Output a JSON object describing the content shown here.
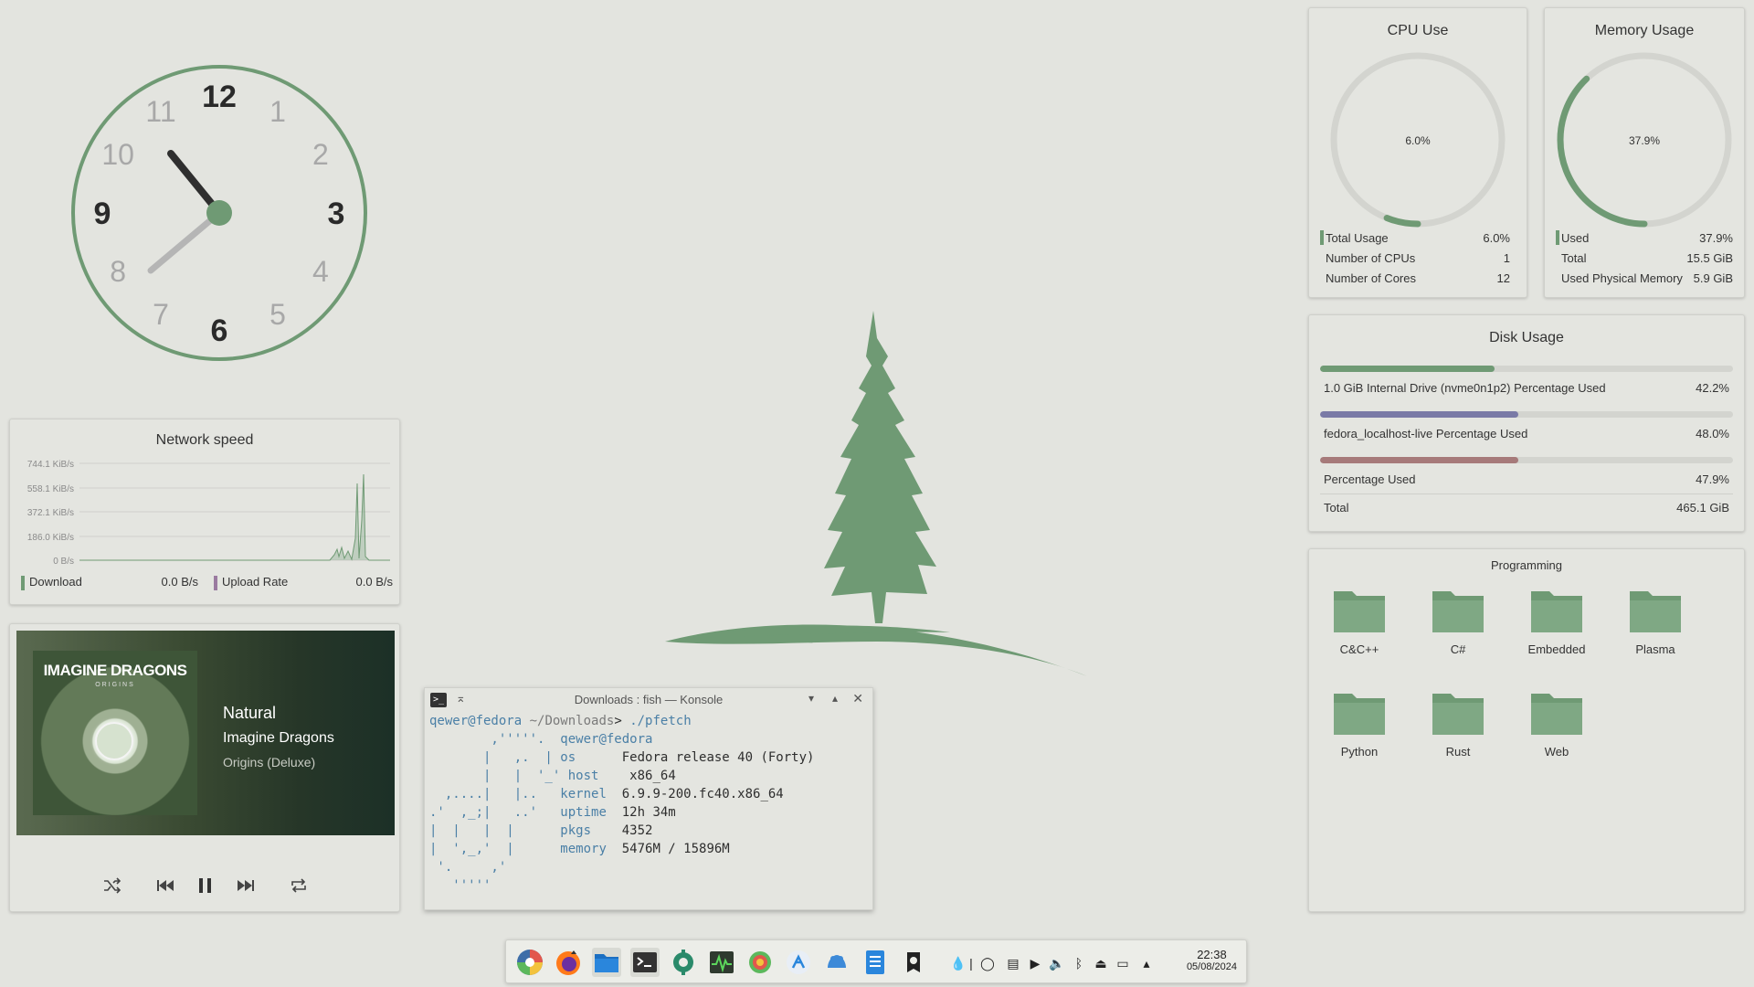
{
  "clock": {
    "numerals": [
      "12",
      "1",
      "2",
      "3",
      "4",
      "5",
      "6",
      "7",
      "8",
      "9",
      "10",
      "11"
    ],
    "time": "22:38"
  },
  "cpu": {
    "title": "CPU Use",
    "gauge_label": "6.0%",
    "gauge_fraction": 0.06,
    "rows": [
      {
        "label": "Total Usage",
        "value": "6.0%"
      },
      {
        "label": "Number of CPUs",
        "value": "1"
      },
      {
        "label": "Number of Cores",
        "value": "12"
      }
    ]
  },
  "memory": {
    "title": "Memory Usage",
    "gauge_label": "37.9%",
    "gauge_fraction": 0.379,
    "rows": [
      {
        "label": "Used",
        "value": "37.9%"
      },
      {
        "label": "Total",
        "value": "15.5 GiB"
      },
      {
        "label": "Used Physical Memory",
        "value": "5.9 GiB"
      }
    ]
  },
  "disk": {
    "title": "Disk Usage",
    "entries": [
      {
        "label": "1.0 GiB Internal Drive (nvme0n1p2) Percentage Used",
        "value": "42.2%",
        "fraction": 0.422,
        "color": "#6f9a74"
      },
      {
        "label": "fedora_localhost-live Percentage Used",
        "value": "48.0%",
        "fraction": 0.48,
        "color": "#7a7aa6"
      },
      {
        "label": "Percentage Used",
        "value": "47.9%",
        "fraction": 0.479,
        "color": "#a67a7a"
      }
    ],
    "total_label": "Total",
    "total_value": "465.1 GiB"
  },
  "folders": {
    "title": "Programming",
    "items": [
      "C&C++",
      "C#",
      "Embedded",
      "Plasma",
      "Python",
      "Rust",
      "Web"
    ]
  },
  "network": {
    "title": "Network speed",
    "y_ticks": [
      "744.1 KiB/s",
      "558.1 KiB/s",
      "372.1 KiB/s",
      "186.0 KiB/s",
      "0 B/s"
    ],
    "download_label": "Download",
    "download_value": "0.0 B/s",
    "upload_label": "Upload Rate",
    "upload_value": "0.0 B/s",
    "download_color": "#6f9a74",
    "upload_color": "#9a7aa0"
  },
  "media": {
    "album_band": "IMAGINE DRAGONS",
    "album_sub": "ORIGINS",
    "track": "Natural",
    "artist": "Imagine Dragons",
    "album": "Origins (Deluxe)",
    "controls": [
      "shuffle-icon",
      "previous-icon",
      "pause-icon",
      "next-icon",
      "repeat-icon"
    ]
  },
  "konsole": {
    "title": "Downloads : fish — Konsole",
    "prompt_user": "qewer@fedora",
    "prompt_path": "~/Downloads",
    "prompt_symbol": ">",
    "command": "./pfetch",
    "header": "qewer@fedora",
    "info": [
      {
        "key": "os",
        "value": "Fedora release 40 (Forty)"
      },
      {
        "key": "host",
        "value": "x86_64"
      },
      {
        "key": "kernel",
        "value": "6.9.9-200.fc40.x86_64"
      },
      {
        "key": "uptime",
        "value": "12h 34m"
      },
      {
        "key": "pkgs",
        "value": "4352"
      },
      {
        "key": "memory",
        "value": "5476M / 15896M"
      }
    ]
  },
  "taskbar": {
    "time": "22:38",
    "date": "05/08/2024",
    "apps": [
      "app-launcher-icon",
      "firefox-icon",
      "files-icon",
      "terminal-icon",
      "settings-icon",
      "system-monitor-icon",
      "disk-usage-icon",
      "kde-connect-icon",
      "discover-icon",
      "writer-icon",
      "steam-icon"
    ]
  },
  "colors": {
    "accent": "#6f9a74",
    "background": "#e3e4df"
  }
}
